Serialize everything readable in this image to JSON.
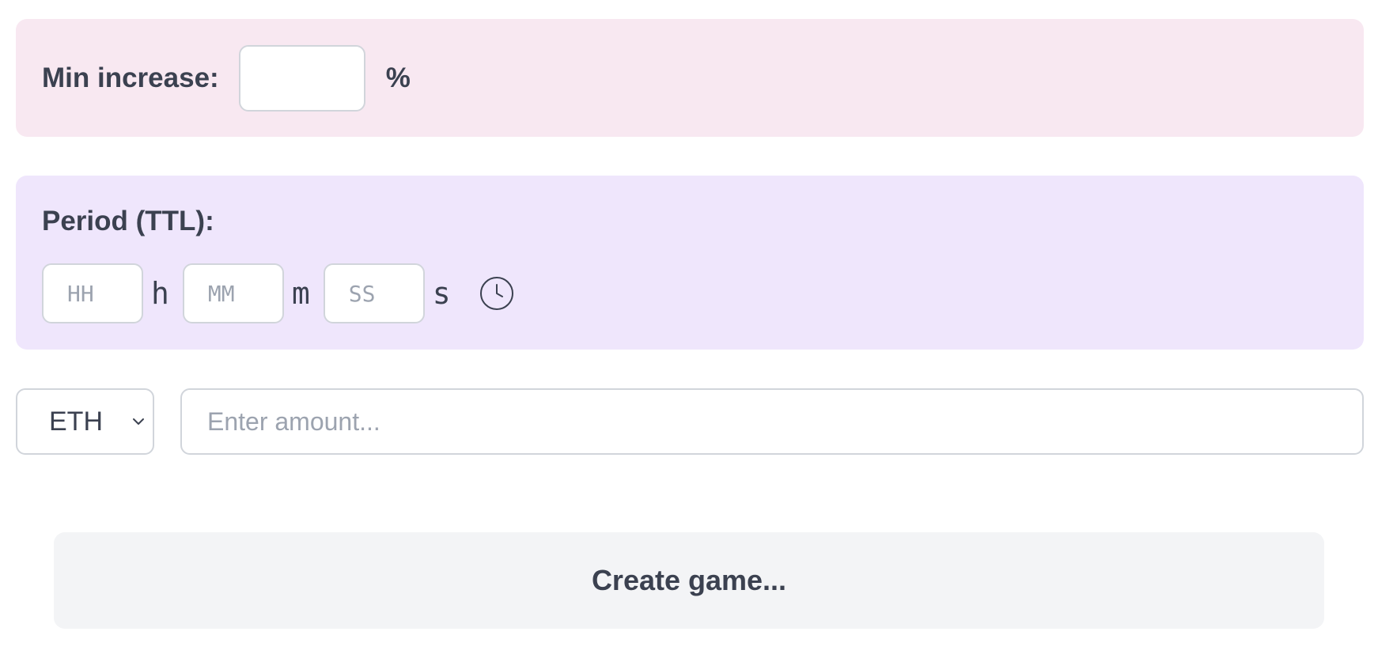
{
  "min_increase": {
    "label": "Min increase:",
    "value": "",
    "unit": "%"
  },
  "period": {
    "label": "Period (TTL):",
    "hours_placeholder": "HH",
    "hours_unit": "h",
    "minutes_placeholder": "MM",
    "minutes_unit": "m",
    "seconds_placeholder": "SS",
    "seconds_unit": "s",
    "picker_icon": "clock-icon"
  },
  "currency": {
    "selected": "ETH",
    "icon": "chevron-down-icon"
  },
  "amount": {
    "placeholder": "Enter amount...",
    "value": ""
  },
  "create_button": {
    "label": "Create game..."
  },
  "colors": {
    "min_panel_bg": "#f8e8f1",
    "period_panel_bg": "#efe6fc",
    "button_bg": "#f3f4f6",
    "text": "#3b4150",
    "placeholder": "#9ca3af",
    "border": "#d1d5db"
  }
}
